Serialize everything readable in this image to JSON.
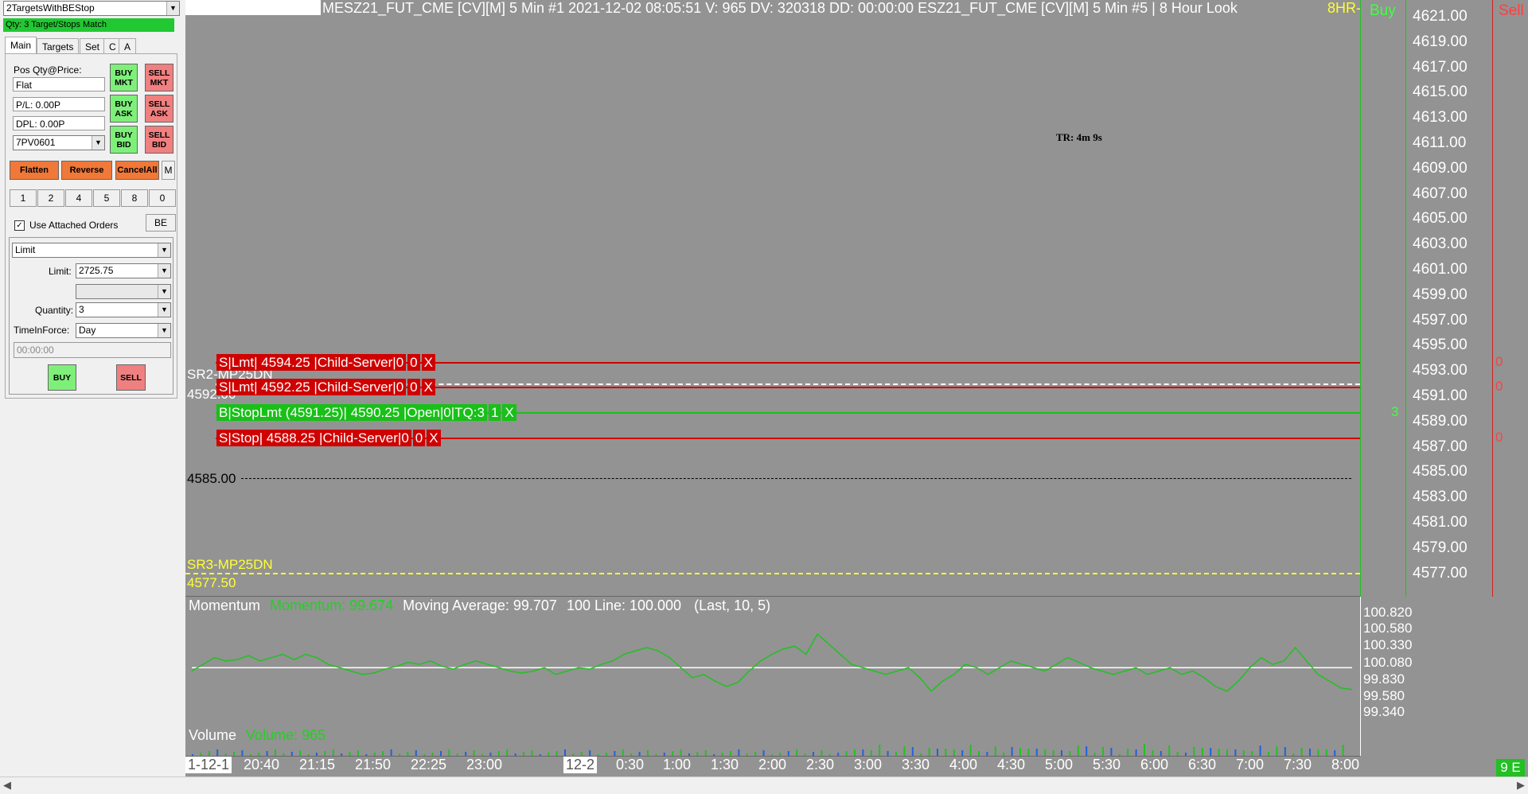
{
  "panel": {
    "strategy_select": "2TargetsWithBEStop",
    "status": "Qty: 3 Target/Stops Match",
    "tabs": [
      "Main",
      "Targets",
      "Set",
      "C",
      "A"
    ],
    "pos_label": "Pos Qty@Price:",
    "pos_value": "Flat",
    "pl_value": "P/L: 0.00P",
    "dpl_value": "DPL: 0.00P",
    "account": "7PV0601",
    "buttons": {
      "buy_mkt": "BUY MKT",
      "sell_mkt": "SELL MKT",
      "buy_ask": "BUY ASK",
      "sell_ask": "SELL ASK",
      "buy_bid": "BUY BID",
      "sell_bid": "SELL BID",
      "flatten": "Flatten",
      "reverse": "Reverse",
      "cancel_all": "CancelAll",
      "m": "M",
      "be": "BE",
      "buy": "BUY",
      "sell": "SELL"
    },
    "qty_buttons": [
      "1",
      "2",
      "4",
      "5",
      "8",
      "0"
    ],
    "use_attached": "Use Attached Orders",
    "order_type": "Limit",
    "limit_label": "Limit:",
    "limit_value": "2725.75",
    "quantity_label": "Quantity:",
    "quantity_value": "3",
    "tif_label": "TimeInForce:",
    "tif_value": "Day",
    "time_value": "00:00:00"
  },
  "chart": {
    "header": "MESZ21_FUT_CME [CV][M]  5 Min  #1 2021-12-02 08:05:51 V: 965 DV: 320318 DD: 00:00:00 ESZ21_FUT_CME [CV][M]  5 Min  #5 | 8 Hour Look",
    "header_tag": "8HR-",
    "buy_col": "Buy",
    "sell_col": "Sell",
    "tr_label": "TR: 4m 9s",
    "price_axis": [
      "4621.00",
      "4619.00",
      "4617.00",
      "4615.00",
      "4613.00",
      "4611.00",
      "4609.00",
      "4607.00",
      "4605.00",
      "4603.00",
      "4601.00",
      "4599.00",
      "4597.00",
      "4595.00",
      "4593.00",
      "4591.00",
      "4589.00",
      "4587.00",
      "4585.00",
      "4583.00",
      "4581.00",
      "4579.00",
      "4577.00"
    ],
    "orders": [
      {
        "parts": [
          "S|Lmt| 4594.25 |Child-Server|0",
          "0",
          "X"
        ],
        "kind": "red",
        "price": 4594.25,
        "sell_qty": "0"
      },
      {
        "parts": [
          "S|Lmt| 4592.25 |Child-Server|0",
          "0",
          "X"
        ],
        "kind": "red",
        "price": 4592.25,
        "sell_qty": "0"
      },
      {
        "parts": [
          "B|StopLmt (4591.25)| 4590.25 |Open|0|TQ:3",
          "1",
          "X"
        ],
        "kind": "green",
        "price": 4590.25,
        "buy_qty": "3"
      },
      {
        "parts": [
          "S|Stop| 4588.25 |Child-Server|0",
          "0",
          "X"
        ],
        "kind": "red",
        "price": 4588.25,
        "sell_qty": "0"
      }
    ],
    "sr2_name": "SR2-MP25DN",
    "sr2_price": "4592.00",
    "level_4585": "4585.00",
    "sr3_name": "SR3-MP25DN",
    "sr3_price": "4577.50",
    "momentum": {
      "title": "Momentum",
      "value_label": "Momentum: 99.674",
      "ma_label": "Moving Average: 99.707",
      "line_label": "100 Line: 100.000",
      "params": "(Last, 10, 5)",
      "axis": [
        "100.820",
        "100.580",
        "100.330",
        "100.080",
        "99.830",
        "99.580",
        "99.340"
      ]
    },
    "volume": {
      "title": "Volume",
      "value_label": "Volume: 965"
    },
    "time_axis": [
      "1-12-1",
      "20:40",
      "21:15",
      "21:50",
      "22:25",
      "23:00",
      "12-2",
      "0:30",
      "1:00",
      "1:30",
      "2:00",
      "2:30",
      "3:00",
      "3:30",
      "4:00",
      "4:30",
      "5:00",
      "5:30",
      "6:00",
      "6:30",
      "7:00",
      "7:30",
      "8:00"
    ],
    "corner_badge": "9 E"
  },
  "chart_data": {
    "type": "line",
    "title": "Momentum",
    "series": [
      {
        "name": "Momentum",
        "values": [
          99.95,
          100.05,
          100.15,
          100.1,
          100.12,
          100.18,
          100.1,
          100.15,
          100.2,
          100.12,
          100.2,
          100.15,
          100.05,
          100.0,
          99.95,
          99.9,
          99.92,
          99.98,
          100.02,
          100.08,
          100.05,
          100.1,
          100.02,
          99.98,
          100.05,
          100.1,
          100.05,
          100.0,
          99.95,
          99.92,
          99.95,
          100.0,
          99.9,
          99.95,
          100.0,
          99.98,
          100.05,
          100.1,
          100.2,
          100.25,
          100.3,
          100.25,
          100.15,
          100.0,
          99.85,
          99.9,
          99.8,
          99.72,
          99.78,
          99.95,
          100.1,
          100.2,
          100.28,
          100.32,
          100.2,
          100.5,
          100.35,
          100.2,
          100.05,
          100.0,
          99.95,
          99.9,
          99.95,
          100.0,
          99.85,
          99.65,
          99.8,
          99.9,
          100.05,
          100.0,
          99.9,
          100.0,
          100.1,
          100.05,
          100.0,
          99.95,
          100.05,
          100.15,
          100.08,
          100.0,
          99.95,
          99.9,
          99.95,
          100.0,
          99.9,
          99.95,
          100.0,
          99.9,
          99.95,
          99.85,
          99.72,
          99.65,
          99.8,
          100.0,
          100.15,
          100.05,
          100.1,
          100.3,
          100.1,
          99.9,
          99.8,
          99.7,
          99.674
        ]
      }
    ],
    "ylim": [
      99.34,
      100.82
    ]
  }
}
